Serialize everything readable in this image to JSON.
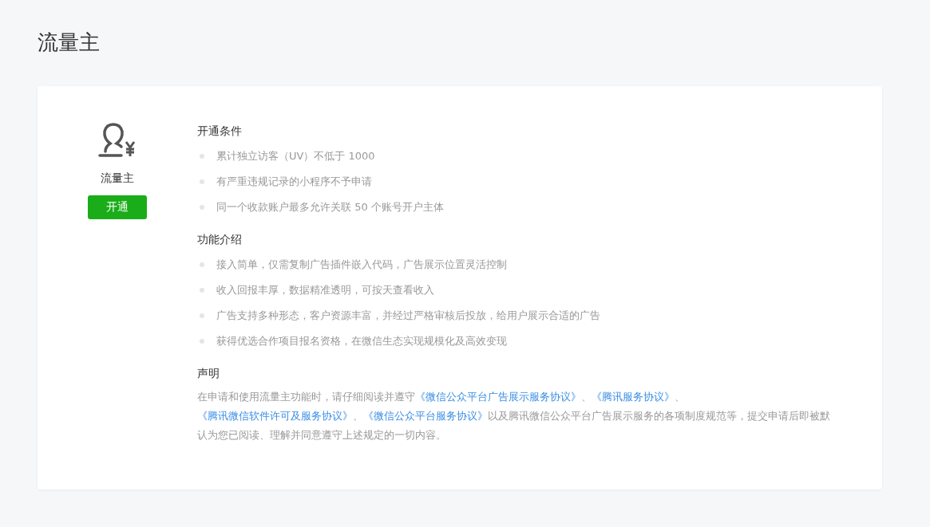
{
  "page": {
    "title": "流量主"
  },
  "profile": {
    "name": "流量主",
    "button": "开通"
  },
  "sections": [
    {
      "title": "开通条件",
      "items": [
        "累计独立访客（UV）不低于 1000",
        "有严重违规记录的小程序不予申请",
        "同一个收款账户最多允许关联 50 个账号开户主体"
      ]
    },
    {
      "title": "功能介绍",
      "items": [
        "接入简单，仅需复制广告插件嵌入代码，广告展示位置灵活控制",
        "收入回报丰厚，数据精准透明，可按天查看收入",
        "广告支持多种形态，客户资源丰富，并经过严格审核后投放，给用户展示合适的广告",
        "获得优选合作项目报名资格，在微信生态实现规模化及高效变现"
      ]
    }
  ],
  "statement": {
    "title": "声明",
    "parts": [
      {
        "kind": "text",
        "text": "在申请和使用流量主功能时，请仔细阅读并遵守"
      },
      {
        "kind": "link",
        "text": "《微信公众平台广告展示服务协议》"
      },
      {
        "kind": "text",
        "text": "、"
      },
      {
        "kind": "link",
        "text": "《腾讯服务协议》"
      },
      {
        "kind": "text",
        "text": "、"
      },
      {
        "kind": "link",
        "text": "《腾讯微信软件许可及服务协议》"
      },
      {
        "kind": "text",
        "text": "、"
      },
      {
        "kind": "link",
        "text": "《微信公众平台服务协议》"
      },
      {
        "kind": "text",
        "text": "以及腾讯微信公众平台广告展示服务的各项制度规范等，提交申请后即被默认为您已阅读、理解并同意遵守上述规定的一切内容。"
      }
    ]
  }
}
